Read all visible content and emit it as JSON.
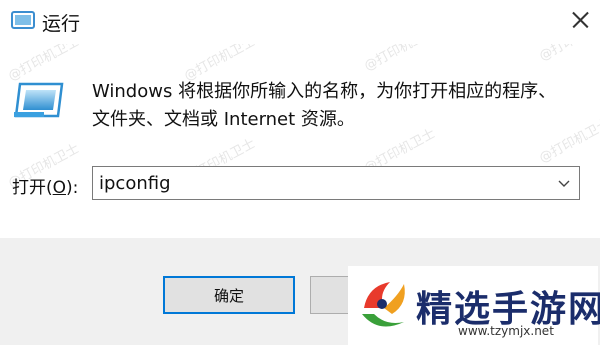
{
  "window": {
    "title": "运行",
    "close_icon": "close-icon",
    "app_icon": "run-app-icon"
  },
  "content": {
    "description_line1": "Windows 将根据你所输入的名称，为你打开相应的程序、",
    "description_line2": "文件夹、文档或 Internet 资源。",
    "open_label_prefix": "打开(",
    "open_label_accel": "O",
    "open_label_suffix": "):",
    "open_value": "ipconfig"
  },
  "buttons": {
    "ok_label": "确定",
    "cancel_label": ""
  },
  "watermark": "@打印机卫士",
  "brand": {
    "name": "精选手游网",
    "url": "www.tzymjx.net"
  },
  "colors": {
    "accent": "#0078d7",
    "footer_bg": "#f0f0f0",
    "brand_text": "#1b2d6b"
  }
}
